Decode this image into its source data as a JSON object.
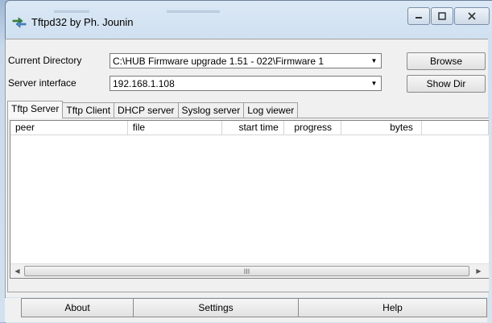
{
  "window": {
    "title": "Tftpd32 by Ph. Jounin",
    "app_icon": "tftpd-arrows-icon",
    "controls": {
      "minimize": "minimize-icon",
      "maximize": "maximize-icon",
      "close": "close-icon"
    }
  },
  "current_directory": {
    "label": "Current Directory",
    "value": "C:\\HUB Firmware upgrade 1.51 - 022\\Firmware 1"
  },
  "server_interface": {
    "label": "Server interface",
    "value": "192.168.1.108"
  },
  "buttons": {
    "browse": "Browse",
    "show_dir": "Show Dir"
  },
  "tabs": [
    {
      "label": "Tftp Server",
      "active": true
    },
    {
      "label": "Tftp Client",
      "active": false
    },
    {
      "label": "DHCP server",
      "active": false
    },
    {
      "label": "Syslog server",
      "active": false
    },
    {
      "label": "Log viewer",
      "active": false
    }
  ],
  "table": {
    "columns": [
      "peer",
      "file",
      "start time",
      "progress",
      "bytes"
    ],
    "rows": []
  },
  "scrollbar": {
    "grip": "III"
  },
  "footer": {
    "about": "About",
    "settings": "Settings",
    "help": "Help"
  }
}
